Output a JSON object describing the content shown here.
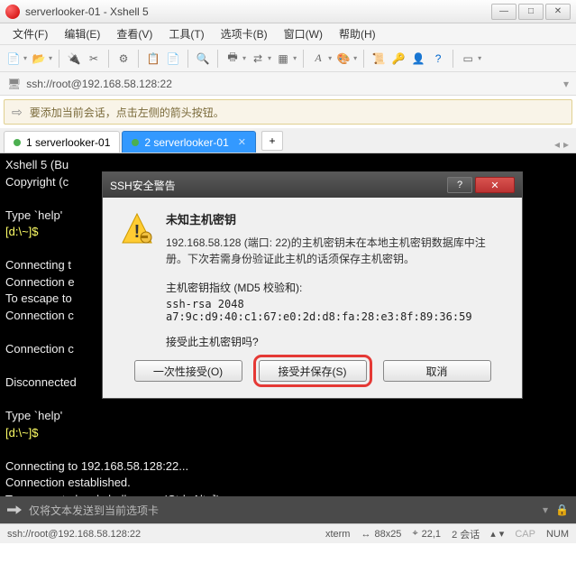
{
  "titlebar": {
    "title": "serverlooker-01 - Xshell 5"
  },
  "menubar": {
    "items": [
      "文件(F)",
      "编辑(E)",
      "查看(V)",
      "工具(T)",
      "选项卡(B)",
      "窗口(W)",
      "帮助(H)"
    ]
  },
  "addressbar": {
    "text": "ssh://root@192.168.58.128:22"
  },
  "infobar": {
    "text": "要添加当前会话，点击左侧的箭头按钮。"
  },
  "tabs": {
    "items": [
      {
        "label": "1 serverlooker-01",
        "active": false
      },
      {
        "label": "2 serverlooker-01",
        "active": true
      }
    ],
    "add_label": "+"
  },
  "terminal": {
    "lines": [
      {
        "cls": "w",
        "t": "Xshell 5 (Bu"
      },
      {
        "cls": "w",
        "t": "Copyright (c"
      },
      {
        "cls": "w",
        "t": ""
      },
      {
        "cls": "w",
        "t": "Type `help' "
      },
      {
        "cls": "y",
        "t": "[d:\\~]$ "
      },
      {
        "cls": "w",
        "t": ""
      },
      {
        "cls": "w",
        "t": "Connecting t"
      },
      {
        "cls": "w",
        "t": "Connection e"
      },
      {
        "cls": "w",
        "t": "To escape to"
      },
      {
        "cls": "w",
        "t": "Connection c"
      },
      {
        "cls": "w",
        "t": ""
      },
      {
        "cls": "w",
        "t": "Connection c"
      },
      {
        "cls": "w",
        "t": ""
      },
      {
        "cls": "w",
        "t": "Disconnected"
      },
      {
        "cls": "w",
        "t": ""
      },
      {
        "cls": "w",
        "t": "Type `help' "
      },
      {
        "cls": "y",
        "t": "[d:\\~]$ "
      },
      {
        "cls": "w",
        "t": ""
      },
      {
        "cls": "w",
        "t": "Connecting to 192.168.58.128:22..."
      },
      {
        "cls": "w",
        "t": "Connection established."
      },
      {
        "cls": "w",
        "t": "To escape to local shell, press 'Ctrl+Alt+]'."
      }
    ]
  },
  "sendbar": {
    "placeholder": "仅将文本发送到当前选项卡"
  },
  "statusbar": {
    "left": "ssh://root@192.168.58.128:22",
    "term": "xterm",
    "size": "88x25",
    "pos": "22,1",
    "sessions": "2 会话",
    "cap": "CAP",
    "num": "NUM"
  },
  "dialog": {
    "title": "SSH安全警告",
    "heading": "未知主机密钥",
    "para": "192.168.58.128 (端口: 22)的主机密钥未在本地主机密钥数据库中注册。下次若需身份验证此主机的话须保存主机密钥。",
    "fplabel": "主机密钥指纹 (MD5 校验和):",
    "fingerprint": "ssh-rsa 2048 a7:9c:d9:40:c1:67:e0:2d:d8:fa:28:e3:8f:89:36:59",
    "ask": "接受此主机密钥吗?",
    "btn_once": "一次性接受(O)",
    "btn_save": "接受并保存(S)",
    "btn_cancel": "取消"
  }
}
